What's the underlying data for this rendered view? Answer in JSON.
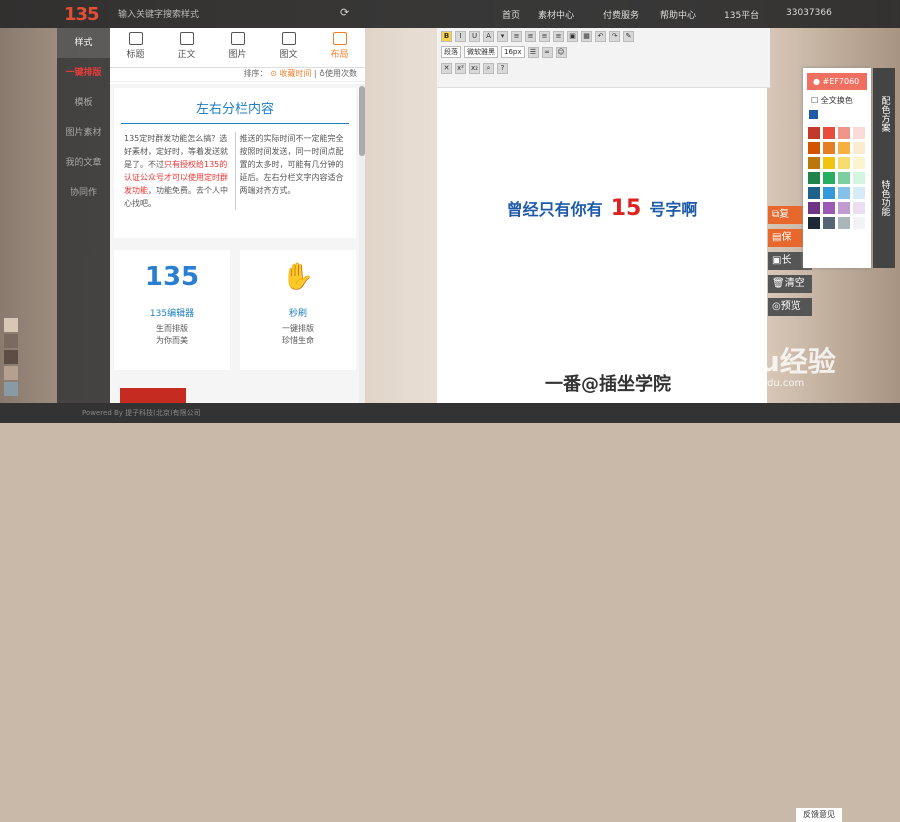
{
  "top": {
    "search_placeholder": "输入关键字搜索样式",
    "nav": [
      "首页",
      "素材中心",
      "付费服务",
      "帮助中心",
      "135平台",
      "33037366"
    ]
  },
  "leftnav": [
    "样式",
    "一键排版",
    "模板",
    "图片素材",
    "我的文章",
    "协同作"
  ],
  "tabs": [
    "标题",
    "正文",
    "图片",
    "图文",
    "布局"
  ],
  "sort": {
    "prefix": "排序：",
    "fav": "收藏时间",
    "use": "使用次数"
  },
  "card": {
    "title": "左右分栏内容",
    "left_text": "135定时群发功能怎么搞？选好素材，定好时，等着发送就是了。不过",
    "left_red": "只有授权给135的认证公众号才可以使用定时群发功能",
    "left_tail": "，功能免费。去个人中心找吧。",
    "right_text": "推送的实际时间不一定能完全按照时间发送，同一时间点配置的太多时，可能有几分钟的延后。左右分栏文字内容适合两端对齐方式。"
  },
  "mini": [
    {
      "name": "135编辑器",
      "desc1": "生而排版",
      "desc2": "为你而美"
    },
    {
      "name": "秒刷",
      "desc1": "一键排版",
      "desc2": "珍惜生命"
    }
  ],
  "toolbar": {
    "para": "段落",
    "font": "微软雅黑",
    "size": "16px"
  },
  "editor": {
    "headline_a": "曾经只有你有",
    "headline_num": "15",
    "headline_b": "号字啊",
    "sig": "一番@插坐学院"
  },
  "side": [
    "复",
    "保",
    "长",
    "清空",
    "预览"
  ],
  "palette": {
    "hex": "#EF7060",
    "check": "全文换色",
    "vlabel1": "配色方案",
    "vlabel2": "特色功能",
    "colors": [
      "#c0392b",
      "#e74c3c",
      "#f1948a",
      "#fadbd8",
      "#d35400",
      "#e67e22",
      "#f5b041",
      "#fdebd0",
      "#b9770e",
      "#f1c40f",
      "#f7dc6f",
      "#fcf3cf",
      "#1e8449",
      "#27ae60",
      "#7dcea0",
      "#d5f5e3",
      "#1f618d",
      "#3498db",
      "#85c1e9",
      "#d6eaf8",
      "#6c3483",
      "#9b59b6",
      "#c39bd3",
      "#ebdef0",
      "#1c2833",
      "#566573",
      "#aab7b8",
      "#f2f3f4"
    ]
  },
  "footer": {
    "text": "Powered By 提子科技(北京)有限公司",
    "feedback": "反馈意见"
  },
  "watermark": {
    "brand": "Baidu经验",
    "url": "jingyan.baidu.com"
  }
}
